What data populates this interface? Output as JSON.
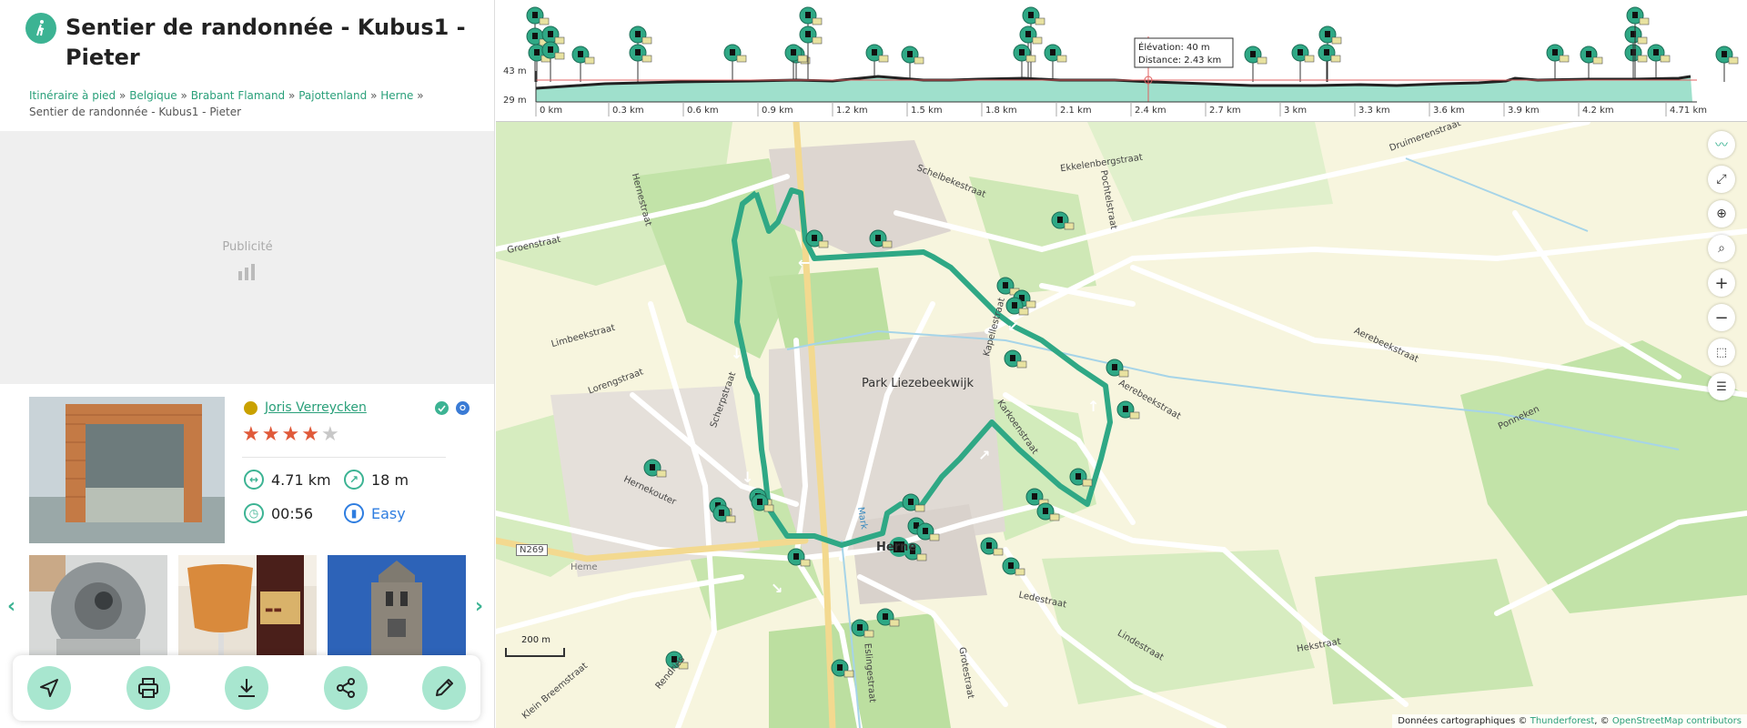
{
  "header": {
    "title": "Sentier de randonnée - Kubus1 - Pieter"
  },
  "breadcrumb": {
    "items": [
      "Itinéraire à pied",
      "Belgique",
      "Brabant Flamand",
      "Pajottenland",
      "Herne"
    ],
    "current": "Sentier de randonnée - Kubus1 - Pieter",
    "separator": "»"
  },
  "ad": {
    "label": "Publicité"
  },
  "author": {
    "name": "Joris Verreycken"
  },
  "rating": {
    "value": 4,
    "max": 5
  },
  "stats": {
    "distance": "4.71 km",
    "elevation": "18 m",
    "duration": "00:56",
    "difficulty": "Easy"
  },
  "elevation_profile": {
    "y_labels": [
      "43 m",
      "29 m"
    ],
    "x_labels": [
      "0 km",
      "0.3 km",
      "0.6 km",
      "0.9 km",
      "1.2 km",
      "1.5 km",
      "1.8 km",
      "2.1 km",
      "2.4 km",
      "2.7 km",
      "3 km",
      "3.3 km",
      "3.6 km",
      "3.9 km",
      "4.2 km",
      "4.71 km"
    ],
    "tooltip": {
      "elevation": "Élévation: 40 m",
      "distance": "Distance: 2.43 km"
    }
  },
  "map": {
    "place_labels": [
      "Park Liezebeekwijk",
      "Herne",
      "Heme"
    ],
    "road_labels": [
      "Groenstraat",
      "Hernestraat",
      "Schelbekestraat",
      "Ekkelenbergstraat",
      "Druimerenstraat",
      "Pochtelstraat",
      "Kapellestraat",
      "Karkoenstraat",
      "Aerebeekstraat",
      "Limbeekstraat",
      "Lorengstraat",
      "Scherpstraat",
      "Hernekouter",
      "Ledestraat",
      "Lindestraat",
      "Hekstraat",
      "Eslingestraat",
      "Grotestraat",
      "Ponneken",
      "N269",
      "Klein Breemstraat",
      "Rendries",
      "Mark",
      "Aerebeekstraat"
    ],
    "scale": "200 m",
    "attribution_prefix": "Données cartographiques ©",
    "attribution_links": [
      "Thunderforest",
      "OpenStreetMap contributors"
    ]
  },
  "colors": {
    "accent": "#3cb393",
    "route": "#2fa885",
    "star": "#e05a3a",
    "link": "#2aa07a"
  }
}
